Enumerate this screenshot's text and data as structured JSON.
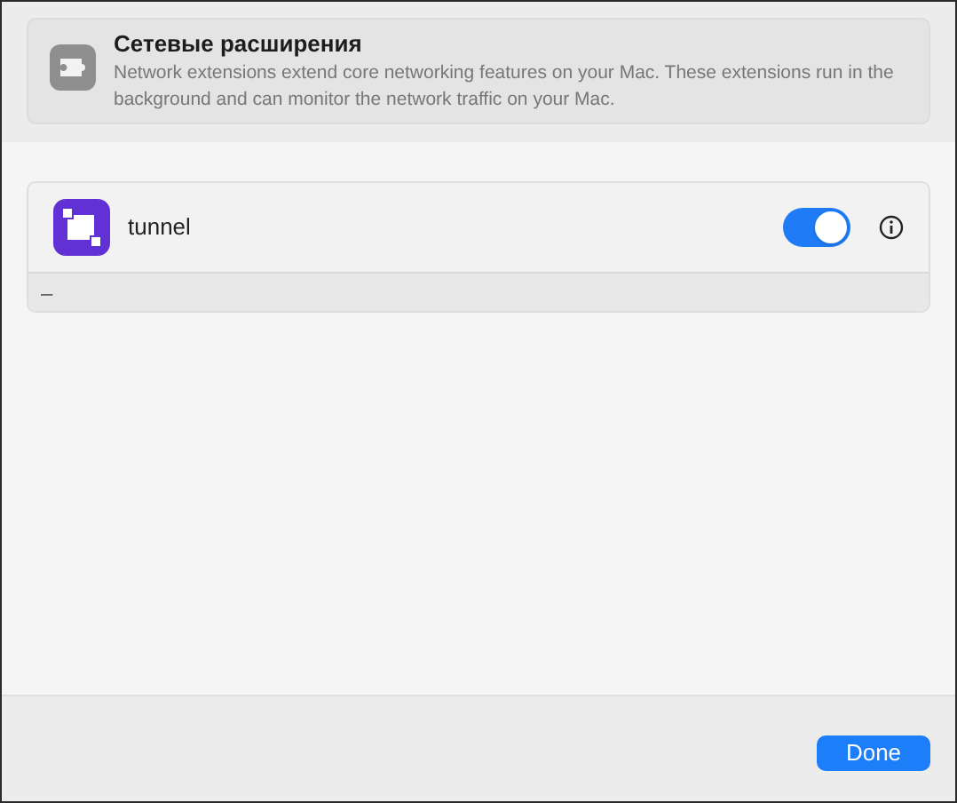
{
  "header": {
    "title": "Сетевые расширения",
    "description": "Network extensions extend core networking features on your Mac. These extensions run in the background and can monitor the network traffic on your Mac."
  },
  "extensions": [
    {
      "name": "tunnel",
      "on": true
    }
  ],
  "list_footer": {
    "remove": "–"
  },
  "buttons": {
    "done": "Done"
  }
}
